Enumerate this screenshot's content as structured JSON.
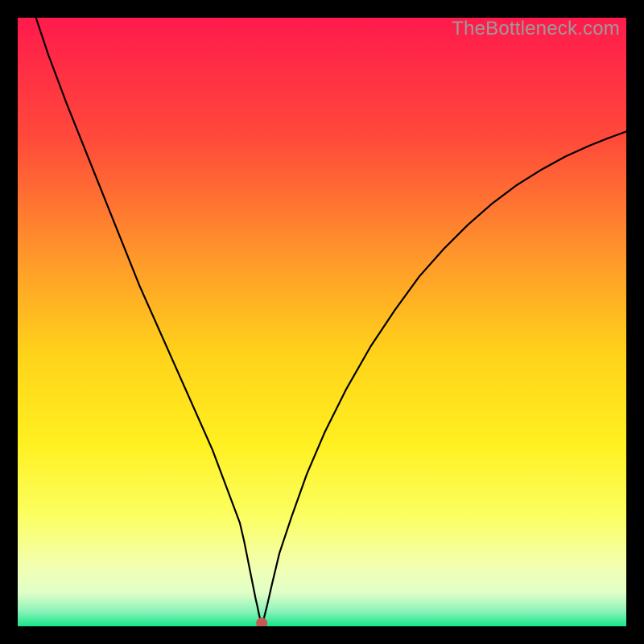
{
  "watermark": "TheBottleneck.com",
  "chart_data": {
    "type": "line",
    "title": "",
    "xlabel": "",
    "ylabel": "",
    "xlim": [
      0,
      100
    ],
    "ylim": [
      0,
      100
    ],
    "grid": false,
    "background_gradient": {
      "direction": "vertical",
      "stops": [
        {
          "pos": 0.0,
          "color": "#ff1a4c"
        },
        {
          "pos": 0.2,
          "color": "#ff4a3a"
        },
        {
          "pos": 0.4,
          "color": "#ff9a2a"
        },
        {
          "pos": 0.55,
          "color": "#ffd21a"
        },
        {
          "pos": 0.7,
          "color": "#fff020"
        },
        {
          "pos": 0.82,
          "color": "#fbff62"
        },
        {
          "pos": 0.9,
          "color": "#f3ffb0"
        },
        {
          "pos": 0.945,
          "color": "#e0ffc8"
        },
        {
          "pos": 0.975,
          "color": "#8cf3b9"
        },
        {
          "pos": 1.0,
          "color": "#17e68a"
        }
      ]
    },
    "series": [
      {
        "name": "bottleneck-curve",
        "color": "#000000",
        "x": [
          3,
          5,
          8,
          12,
          16,
          20,
          24,
          28,
          32,
          35,
          36.5,
          37.2,
          37.8,
          38.3,
          38.8,
          39.1,
          39.4,
          39.6,
          39.8,
          40.0,
          40.2,
          40.5,
          41.0,
          41.8,
          43.0,
          45.0,
          47.5,
          50.5,
          54.0,
          58.0,
          62.0,
          66.0,
          70.0,
          74.0,
          78.0,
          82.0,
          86.0,
          90.0,
          94.0,
          97.0,
          100.0
        ],
        "y": [
          100,
          94,
          86,
          76,
          66,
          56,
          47,
          38,
          29,
          21,
          17,
          14,
          11,
          8.5,
          6,
          4.5,
          3.2,
          2.2,
          1.3,
          0.5,
          0.5,
          1.5,
          3.5,
          7,
          12,
          18,
          25,
          32,
          39,
          46,
          52,
          57.5,
          62,
          66,
          69.5,
          72.5,
          75,
          77.2,
          79,
          80.2,
          81.3
        ]
      }
    ],
    "marker": {
      "name": "optimal-point",
      "x": 40.1,
      "y": 0.5,
      "color": "#c45a52",
      "radius_px": 7
    }
  }
}
